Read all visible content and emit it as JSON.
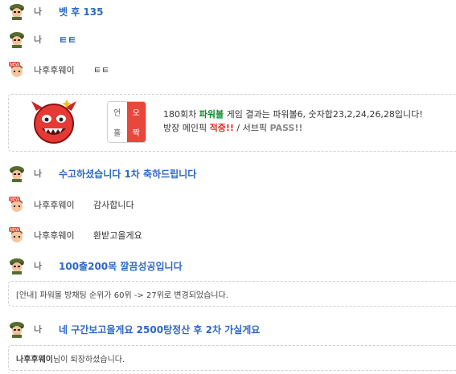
{
  "chat": {
    "messages": [
      {
        "type": "me",
        "nick": "나",
        "text": "벳 후 135"
      },
      {
        "type": "me",
        "nick": "나",
        "text": "ㅌㅌ"
      },
      {
        "type": "other",
        "nick": "나후후웨이",
        "text": "ㅌㅌ"
      },
      {
        "type": "me",
        "nick": "나",
        "text": "수고하셨습니다 1차 축하드립니다"
      },
      {
        "type": "other",
        "nick": "나후후웨이",
        "text": "감사합니다"
      },
      {
        "type": "other",
        "nick": "나후후웨이",
        "text": "환받고올게요"
      },
      {
        "type": "me",
        "nick": "나",
        "text": "100출200목 깔끔성공입니다"
      },
      {
        "type": "me",
        "nick": "나",
        "text": "네 구간보고올게요 2500탕정산 후 2차 가실게요"
      }
    ],
    "result": {
      "odd_even": {
        "odd": "언",
        "even": "오"
      },
      "big_small": {
        "small": "홀",
        "big": "짝"
      },
      "line1_pre": "180회차 ",
      "line1_game": "파워볼",
      "line1_post": " 게임 결과는 파워볼6, 숫자합23,2,24,26,28입니다!",
      "line2_pre": "방장 메인픽 ",
      "line2_hit": "적중!!",
      "line2_mid": " / 서브픽 ",
      "line2_pass": "PASS!!"
    },
    "notice_change": "[안내] 파워볼 방채팅 순위가 60위 -> 27위로 변경되었습니다.",
    "leave": {
      "name": "나후후웨이",
      "suffix": "님이 퇴장하셨습니다."
    }
  },
  "colors": {
    "me_text": "#2c67c4",
    "powerball": "#0b8a2b",
    "hit": "#e03030",
    "ladder_active": "#e8473c"
  }
}
